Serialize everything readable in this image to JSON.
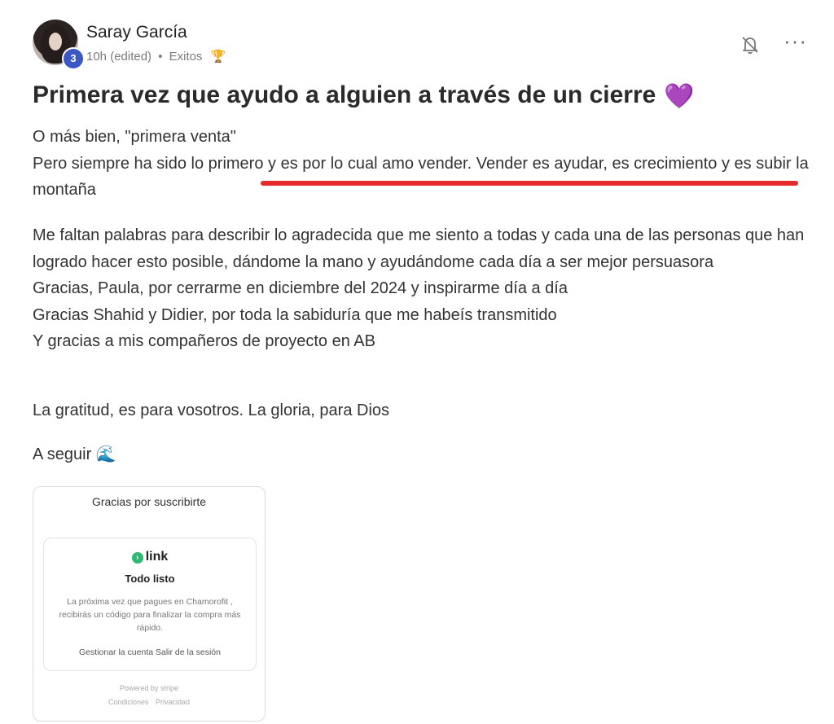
{
  "author": {
    "name": "Saray García",
    "level": "3",
    "time": "10h (edited)",
    "separator": "•",
    "category": "Exitos",
    "category_icon": "trophy-icon"
  },
  "actions": {
    "notify_icon": "bell-off-icon",
    "more_icon": "more-options-icon",
    "more_glyph": "···"
  },
  "post": {
    "title": "Primera vez que ayudo a alguien a través de un cierre",
    "title_emoji": "💜",
    "paragraphs": [
      "O más bien, \"primera venta\"\nPero siempre ha sido lo primero y es por lo cual amo vender. Vender es ayudar, es crecimiento y es subir la montaña",
      "Me faltan palabras para describir lo agradecida que me siento a todas y cada una de las personas que han logrado hacer esto posible, dándome la mano y ayudándome cada día a ser mejor persuasora\nGracias, Paula, por cerrarme en diciembre del 2024 y inspirarme día a día\nGracias Shahid y Didier, por toda la sabiduría que me habeís transmitido\nY gracias a mis compañeros de proyecto en AB",
      "La gratitud, es para vosotros. La gloria, para Dios",
      "A seguir 🌊"
    ],
    "highlight_color": "#e8292b"
  },
  "attachment": {
    "title": "Gracias por suscribirte",
    "brand": "link",
    "heading": "Todo listo",
    "body": "La próxima vez que pagues en Chamorofit , recibirás un código para finalizar la compra más rápido.",
    "actions": "Gestionar la cuenta   Salir de la sesión",
    "powered_by": "Powered by stripe",
    "legal": "Condiciones   Privacidad"
  }
}
